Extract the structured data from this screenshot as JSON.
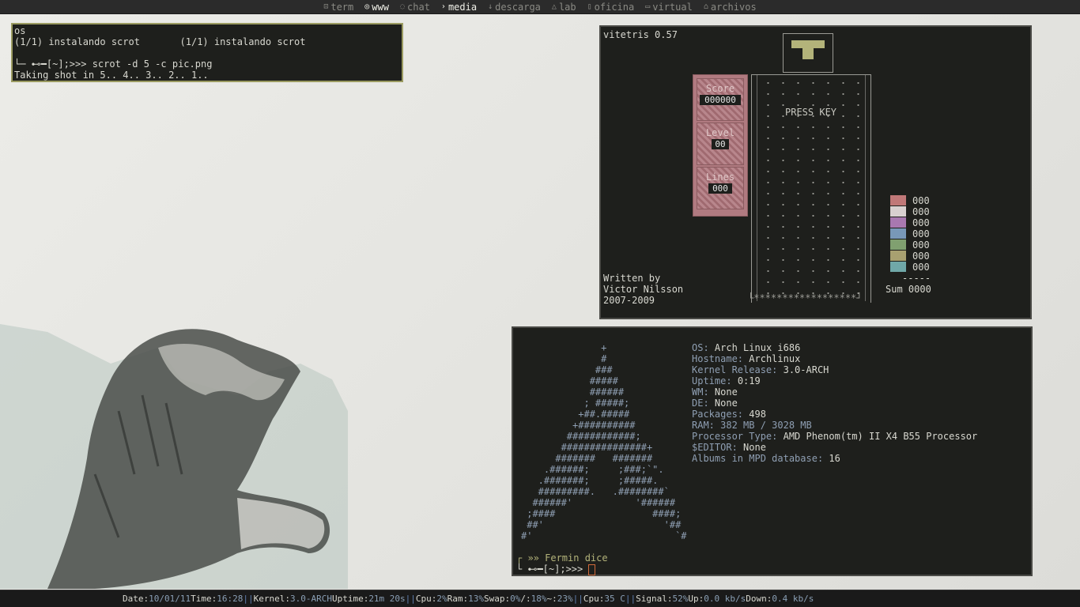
{
  "topbar": {
    "workspaces": [
      {
        "icon": "term-icon",
        "glyph": "⊡",
        "label": "term",
        "active": false
      },
      {
        "icon": "www-icon",
        "glyph": "◎",
        "label": "www",
        "active": true
      },
      {
        "icon": "chat-icon",
        "glyph": "◌",
        "label": "chat",
        "active": false
      },
      {
        "icon": "media-icon",
        "glyph": "›",
        "label": "media",
        "active": true
      },
      {
        "icon": "download-icon",
        "glyph": "↓",
        "label": "descarga",
        "active": false
      },
      {
        "icon": "lab-icon",
        "glyph": "△",
        "label": "lab",
        "active": false
      },
      {
        "icon": "office-icon",
        "glyph": "▯",
        "label": "oficina",
        "active": false
      },
      {
        "icon": "virtual-icon",
        "glyph": "▭",
        "label": "virtual",
        "active": false
      },
      {
        "icon": "files-icon",
        "glyph": "⌂",
        "label": "archivos",
        "active": false
      }
    ]
  },
  "term1": {
    "lines": [
      "os",
      "(1/1) instalando scrot       (1/1) instalando scrot",
      "",
      "└─ ⊷━[~];>>> scrot -d 5 -c pic.png",
      "Taking shot in 5.. 4.. 3.. 2.. 1.."
    ]
  },
  "tetris": {
    "title": "vitetris 0.57",
    "score_label": "Score",
    "score": "000000",
    "level_label": "Level",
    "level": "00",
    "lines_label": "Lines",
    "lines": "000",
    "press_key": "PRESS KEY",
    "credit1": "Written by",
    "credit2": "Victor Nilsson",
    "credit3": "2007-2009",
    "piece_counts": [
      "000",
      "000",
      "000",
      "000",
      "000",
      "000",
      "000"
    ],
    "piece_colors": [
      "#c07878",
      "#d8d0d0",
      "#a878b0",
      "#7898b8",
      "#80a070",
      "#a8a070",
      "#70a8a8"
    ],
    "sum_rule": "-----",
    "sum_label": "Sum 0000",
    "floor": "└******************┘"
  },
  "info": {
    "ascii": [
      "              +",
      "              #",
      "             ###",
      "            #####",
      "            ######",
      "           ; #####;",
      "          +##.#####",
      "         +##########",
      "        ############;",
      "       ###############+",
      "      #######   #######",
      "    .######;     ;###;`\".",
      "   .#######;     ;#####.",
      "   #########.   .########`",
      "  ######'           '######",
      " ;####                 ####;",
      " ##'                     '##",
      "#'                         `#"
    ],
    "fields": [
      {
        "k": "OS:",
        "v": "Arch Linux i686"
      },
      {
        "k": "Hostname:",
        "v": "Archlinux"
      },
      {
        "k": "Kernel Release:",
        "v": "3.0-ARCH"
      },
      {
        "k": "Uptime:",
        "v": "0:19"
      },
      {
        "k": "WM:",
        "v": "None"
      },
      {
        "k": "DE:",
        "v": "None"
      },
      {
        "k": "Packages:",
        "v": "498"
      },
      {
        "k": "RAM:",
        "v": "382 MB / 3028 MB"
      },
      {
        "k": "Processor Type:",
        "v": "AMD Phenom(tm) II X4 B55 Processor"
      },
      {
        "k": "$EDITOR:",
        "v": "None"
      },
      {
        "k": "Albums in MPD database:",
        "v": "16"
      }
    ],
    "prompt1": "┌ »» Fermin dice",
    "prompt2": "└ ⊷━[~];>>> "
  },
  "status": {
    "items": [
      {
        "k": "Date:",
        "v": "10/01/11"
      },
      {
        "k": "Time:",
        "v": "16:28"
      },
      {
        "sep": "||"
      },
      {
        "k": "Kernel:",
        "v": "3.0-ARCH"
      },
      {
        "k": "Uptime:",
        "v": "21m 20s"
      },
      {
        "sep": "||"
      },
      {
        "k": "Cpu:",
        "v": "2%"
      },
      {
        "k": "Ram:",
        "v": "13%"
      },
      {
        "k": "Swap:",
        "v": "0%"
      },
      {
        "k": "/:",
        "v": "18%"
      },
      {
        "k": "~:",
        "v": "23%"
      },
      {
        "sep": "||"
      },
      {
        "k": "Cpu:",
        "v": "35 C"
      },
      {
        "sep": "||"
      },
      {
        "k": "Signal:",
        "v": "52%"
      },
      {
        "k": "Up:",
        "v": "0.0 kb/s"
      },
      {
        "k": "Down:",
        "v": "0.4 kb/s"
      }
    ]
  }
}
